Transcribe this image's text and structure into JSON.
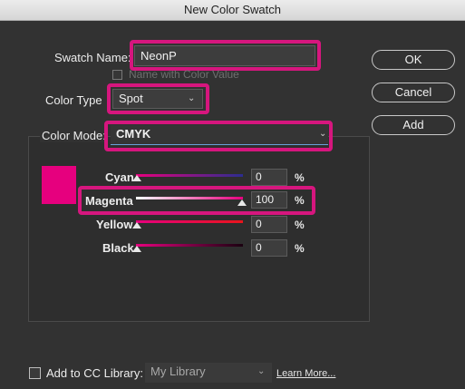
{
  "window": {
    "title": "New Color Swatch"
  },
  "swatch_name": {
    "label": "Swatch Name:",
    "value": "NeonP"
  },
  "name_with_value": {
    "label": "Name with Color Value"
  },
  "color_type": {
    "label": "Color Type",
    "value": "Spot"
  },
  "color_mode": {
    "label": "Color Mode:",
    "value": "CMYK"
  },
  "buttons": {
    "ok": "OK",
    "cancel": "Cancel",
    "add": "Add"
  },
  "sliders": [
    {
      "label": "Cyan",
      "value": "0",
      "unit": "%",
      "fraction": 0
    },
    {
      "label": "Magenta",
      "value": "100",
      "unit": "%",
      "fraction": 1
    },
    {
      "label": "Yellow",
      "value": "0",
      "unit": "%",
      "fraction": 0
    },
    {
      "label": "Black",
      "value": "0",
      "unit": "%",
      "fraction": 0
    }
  ],
  "swatch_color": "#e6007e",
  "highlight_color": "#d6167e",
  "footer": {
    "add_to_cc_label": "Add to CC Library:",
    "library_value": "My Library",
    "learn_more": "Learn More..."
  }
}
